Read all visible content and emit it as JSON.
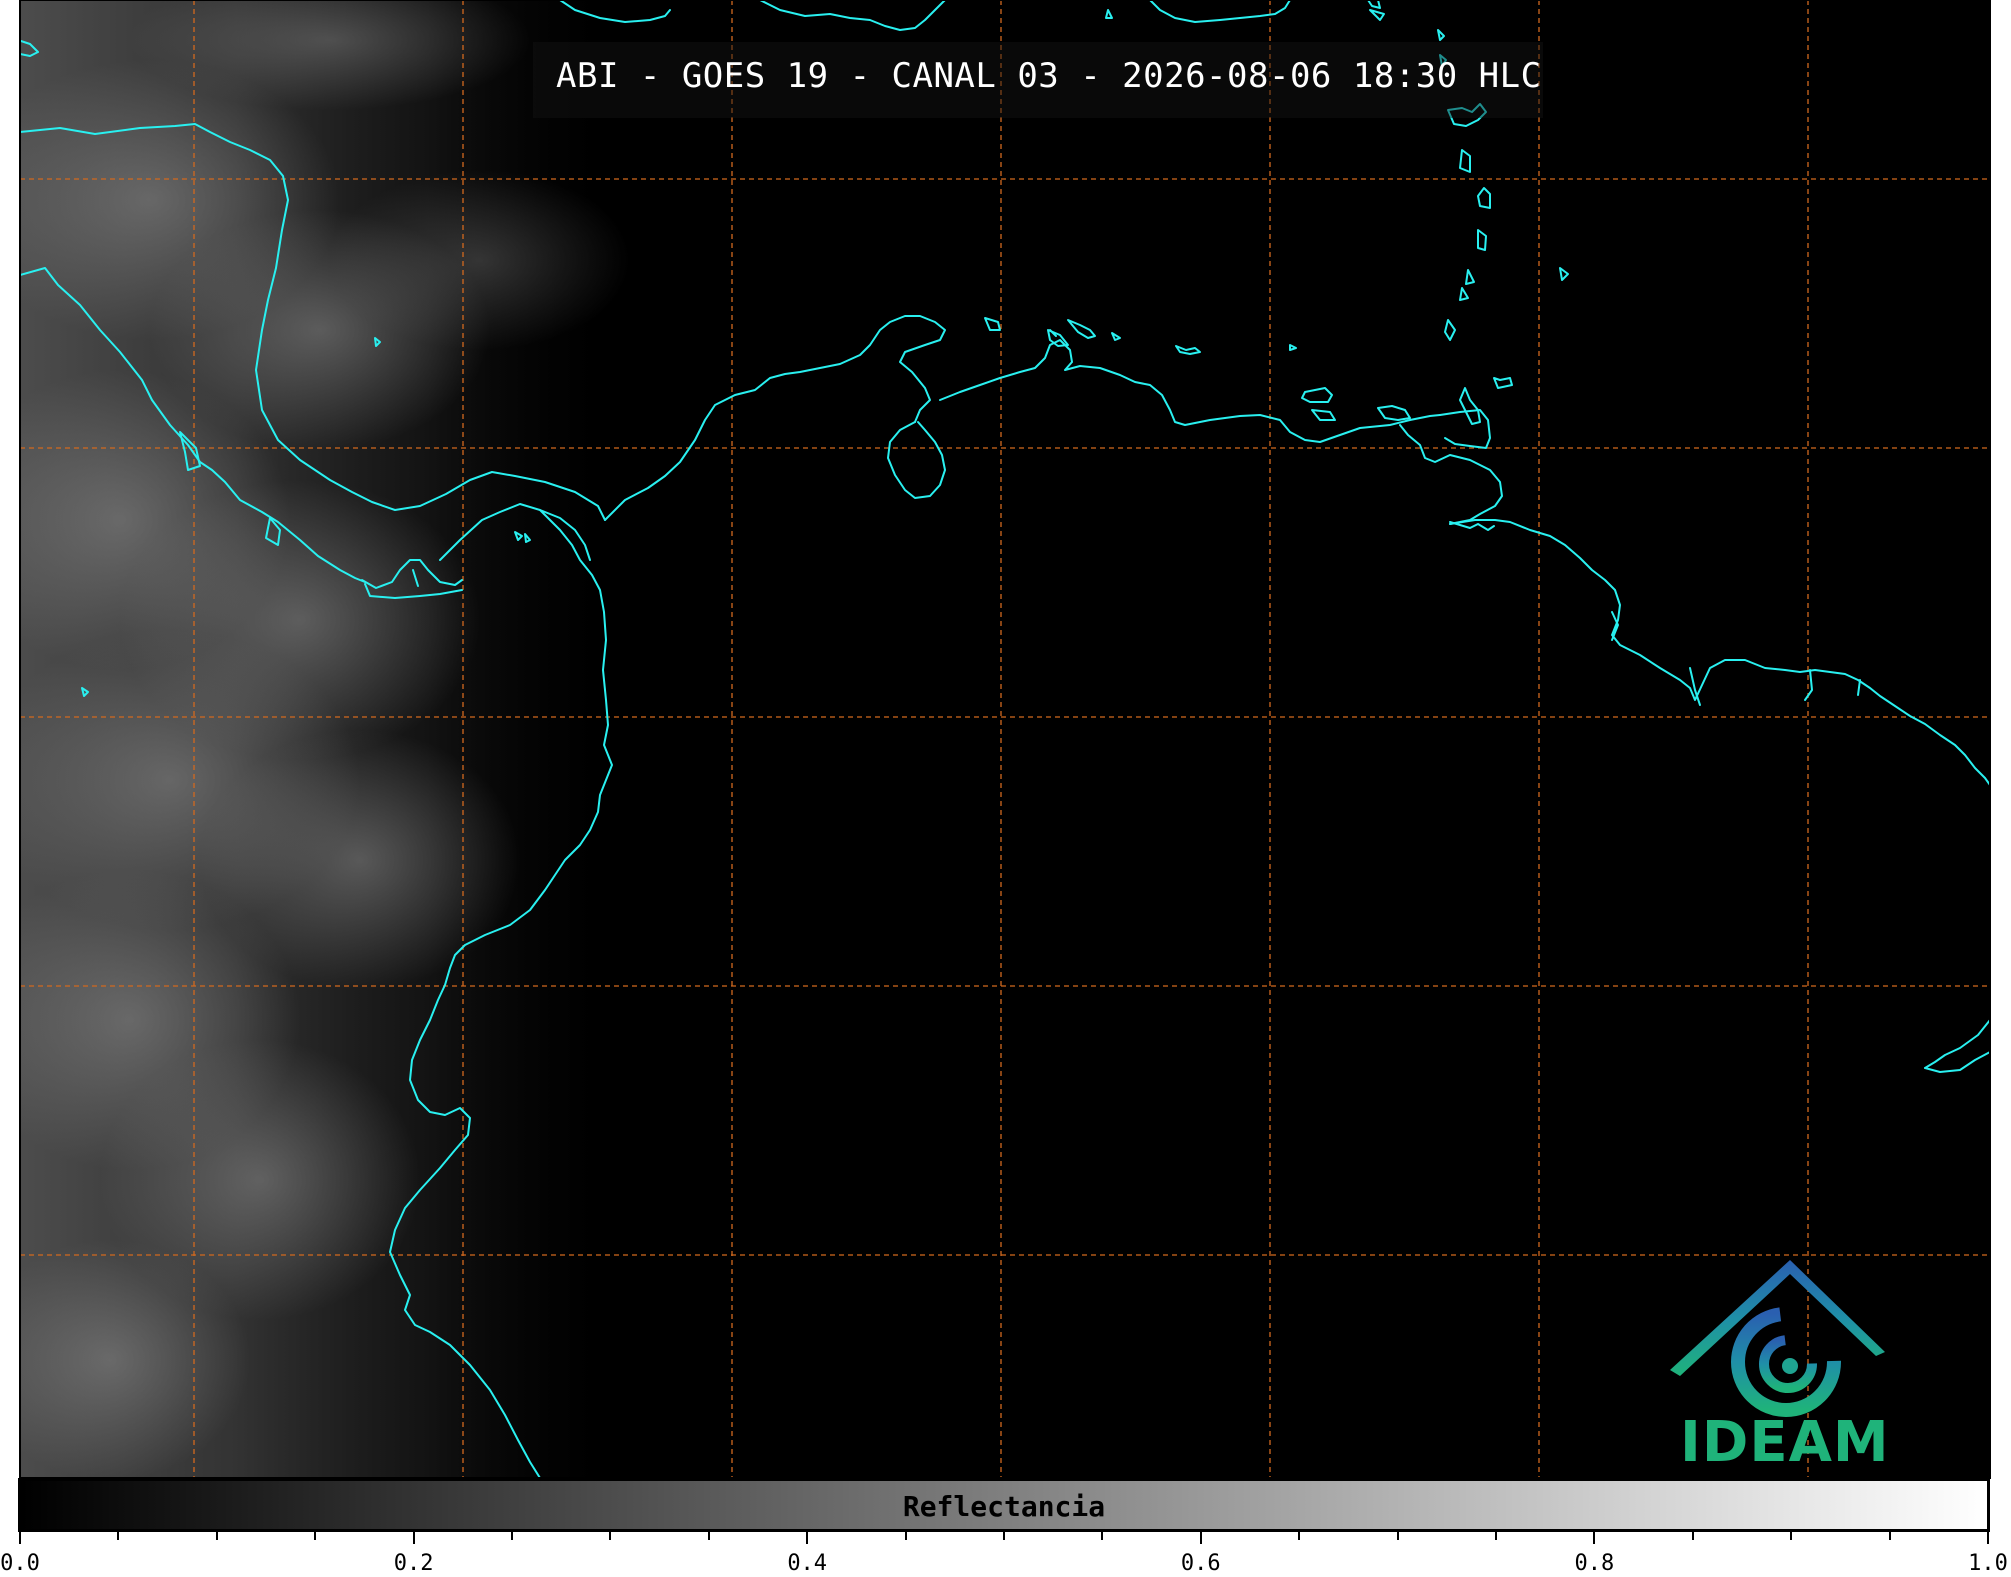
{
  "title": "ABI - GOES 19 - CANAL 03 - 2026-08-06 18:30 HLC",
  "colorbar": {
    "label": "Reflectancia",
    "min": 0.0,
    "max": 1.0,
    "tick_labels": [
      "0.0",
      "0.2",
      "0.4",
      "0.6",
      "0.8",
      "1.0"
    ],
    "colormap_start": "#000000",
    "colormap_end": "#ffffff"
  },
  "logo": {
    "text": "IDEAM",
    "icon": "ideam-logo-icon",
    "color": "#1fb37a"
  },
  "map": {
    "coastline_color": "#29f0f0",
    "graticule_color": "#d2691e",
    "background": "#000000"
  }
}
